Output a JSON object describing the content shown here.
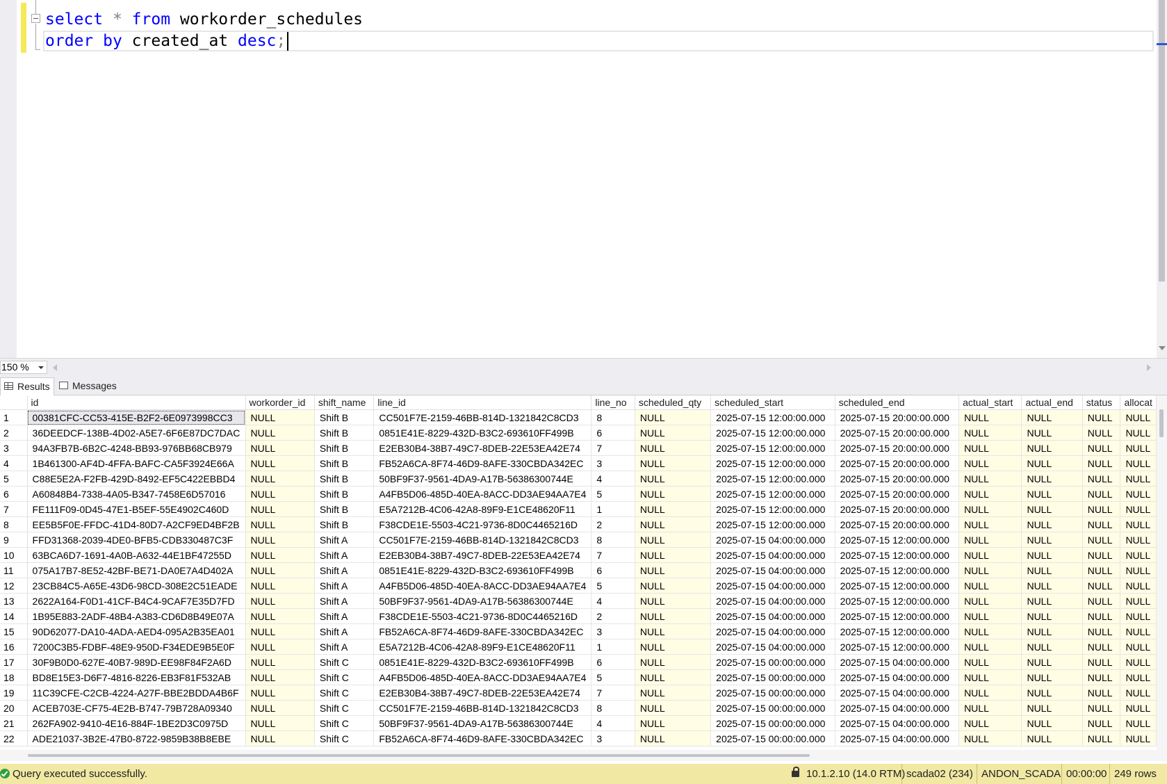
{
  "editor": {
    "line1": {
      "kw1": "select",
      "op": "*",
      "kw2": "from",
      "ident": "workorder_schedules"
    },
    "line2": {
      "kw1": "order",
      "kw2": "by",
      "ident": "created_at",
      "kw3": "desc",
      "punct": ";"
    }
  },
  "zoom": {
    "value": "150 %"
  },
  "tabs": {
    "results": "Results",
    "messages": "Messages"
  },
  "grid": {
    "columns": [
      "",
      "id",
      "workorder_id",
      "shift_name",
      "line_id",
      "line_no",
      "scheduled_qty",
      "scheduled_start",
      "scheduled_end",
      "actual_start",
      "actual_end",
      "status",
      "allocat"
    ],
    "rows": [
      [
        "1",
        "00381CFC-CC53-415E-B2F2-6E0973998CC3",
        "NULL",
        "Shift B",
        "CC501F7E-2159-46BB-814D-1321842C8CD3",
        "8",
        "NULL",
        "2025-07-15 12:00:00.000",
        "2025-07-15 20:00:00.000",
        "NULL",
        "NULL",
        "NULL",
        "NULL"
      ],
      [
        "2",
        "36DEEDCF-138B-4D02-A5E7-6F6E87DC7DAC",
        "NULL",
        "Shift B",
        "0851E41E-8229-432D-B3C2-693610FF499B",
        "6",
        "NULL",
        "2025-07-15 12:00:00.000",
        "2025-07-15 20:00:00.000",
        "NULL",
        "NULL",
        "NULL",
        "NULL"
      ],
      [
        "3",
        "94A3FB7B-6B2C-4248-BB93-976BB68CB979",
        "NULL",
        "Shift B",
        "E2EB30B4-38B7-49C7-8DEB-22E53EA42E74",
        "7",
        "NULL",
        "2025-07-15 12:00:00.000",
        "2025-07-15 20:00:00.000",
        "NULL",
        "NULL",
        "NULL",
        "NULL"
      ],
      [
        "4",
        "1B461300-AF4D-4FFA-BAFC-CA5F3924E66A",
        "NULL",
        "Shift B",
        "FB52A6CA-8F74-46D9-8AFE-330CBDA342EC",
        "3",
        "NULL",
        "2025-07-15 12:00:00.000",
        "2025-07-15 20:00:00.000",
        "NULL",
        "NULL",
        "NULL",
        "NULL"
      ],
      [
        "5",
        "C88E5E2A-F2FB-429D-8492-EF5C422EBBD4",
        "NULL",
        "Shift B",
        "50BF9F37-9561-4DA9-A17B-56386300744E",
        "4",
        "NULL",
        "2025-07-15 12:00:00.000",
        "2025-07-15 20:00:00.000",
        "NULL",
        "NULL",
        "NULL",
        "NULL"
      ],
      [
        "6",
        "A60848B4-7338-4A05-B347-7458E6D57016",
        "NULL",
        "Shift B",
        "A4FB5D06-485D-40EA-8ACC-DD3AE94AA7E4",
        "5",
        "NULL",
        "2025-07-15 12:00:00.000",
        "2025-07-15 20:00:00.000",
        "NULL",
        "NULL",
        "NULL",
        "NULL"
      ],
      [
        "7",
        "FE111F09-0D45-47E1-B5EF-55E4902C460D",
        "NULL",
        "Shift B",
        "E5A7212B-4C06-42A8-89F9-E1CE48620F11",
        "1",
        "NULL",
        "2025-07-15 12:00:00.000",
        "2025-07-15 20:00:00.000",
        "NULL",
        "NULL",
        "NULL",
        "NULL"
      ],
      [
        "8",
        "EE5B5F0E-FFDC-41D4-80D7-A2CF9ED4BF2B",
        "NULL",
        "Shift B",
        "F38CDE1E-5503-4C21-9736-8D0C4465216D",
        "2",
        "NULL",
        "2025-07-15 12:00:00.000",
        "2025-07-15 20:00:00.000",
        "NULL",
        "NULL",
        "NULL",
        "NULL"
      ],
      [
        "9",
        "FFD31368-2039-4DE0-BFB5-CDB330487C3F",
        "NULL",
        "Shift A",
        "CC501F7E-2159-46BB-814D-1321842C8CD3",
        "8",
        "NULL",
        "2025-07-15 04:00:00.000",
        "2025-07-15 12:00:00.000",
        "NULL",
        "NULL",
        "NULL",
        "NULL"
      ],
      [
        "10",
        "63BCA6D7-1691-4A0B-A632-44E1BF47255D",
        "NULL",
        "Shift A",
        "E2EB30B4-38B7-49C7-8DEB-22E53EA42E74",
        "7",
        "NULL",
        "2025-07-15 04:00:00.000",
        "2025-07-15 12:00:00.000",
        "NULL",
        "NULL",
        "NULL",
        "NULL"
      ],
      [
        "11",
        "075A17B7-8E52-42BF-BE71-DA0E7A4D402A",
        "NULL",
        "Shift A",
        "0851E41E-8229-432D-B3C2-693610FF499B",
        "6",
        "NULL",
        "2025-07-15 04:00:00.000",
        "2025-07-15 12:00:00.000",
        "NULL",
        "NULL",
        "NULL",
        "NULL"
      ],
      [
        "12",
        "23CB84C5-A65E-43D6-98CD-308E2C51EADE",
        "NULL",
        "Shift A",
        "A4FB5D06-485D-40EA-8ACC-DD3AE94AA7E4",
        "5",
        "NULL",
        "2025-07-15 04:00:00.000",
        "2025-07-15 12:00:00.000",
        "NULL",
        "NULL",
        "NULL",
        "NULL"
      ],
      [
        "13",
        "2622A164-F0D1-41CF-B4C4-9CAF7E35D7FD",
        "NULL",
        "Shift A",
        "50BF9F37-9561-4DA9-A17B-56386300744E",
        "4",
        "NULL",
        "2025-07-15 04:00:00.000",
        "2025-07-15 12:00:00.000",
        "NULL",
        "NULL",
        "NULL",
        "NULL"
      ],
      [
        "14",
        "1B95E883-2ADF-48B4-A383-CD6D8B49E07A",
        "NULL",
        "Shift A",
        "F38CDE1E-5503-4C21-9736-8D0C4465216D",
        "2",
        "NULL",
        "2025-07-15 04:00:00.000",
        "2025-07-15 12:00:00.000",
        "NULL",
        "NULL",
        "NULL",
        "NULL"
      ],
      [
        "15",
        "90D62077-DA10-4ADA-AED4-095A2B35EA01",
        "NULL",
        "Shift A",
        "FB52A6CA-8F74-46D9-8AFE-330CBDA342EC",
        "3",
        "NULL",
        "2025-07-15 04:00:00.000",
        "2025-07-15 12:00:00.000",
        "NULL",
        "NULL",
        "NULL",
        "NULL"
      ],
      [
        "16",
        "7200C3B5-FDBF-48E9-950D-F34EDE9B5E0F",
        "NULL",
        "Shift A",
        "E5A7212B-4C06-42A8-89F9-E1CE48620F11",
        "1",
        "NULL",
        "2025-07-15 04:00:00.000",
        "2025-07-15 12:00:00.000",
        "NULL",
        "NULL",
        "NULL",
        "NULL"
      ],
      [
        "17",
        "30F9B0D0-627E-40B7-989D-EE98F84F2A6D",
        "NULL",
        "Shift C",
        "0851E41E-8229-432D-B3C2-693610FF499B",
        "6",
        "NULL",
        "2025-07-15 00:00:00.000",
        "2025-07-15 04:00:00.000",
        "NULL",
        "NULL",
        "NULL",
        "NULL"
      ],
      [
        "18",
        "BD8E15E3-D6F7-4816-8226-EB3F81F532AB",
        "NULL",
        "Shift C",
        "A4FB5D06-485D-40EA-8ACC-DD3AE94AA7E4",
        "5",
        "NULL",
        "2025-07-15 00:00:00.000",
        "2025-07-15 04:00:00.000",
        "NULL",
        "NULL",
        "NULL",
        "NULL"
      ],
      [
        "19",
        "11C39CFE-C2CB-4224-A27F-BBE2BDDA4B6F",
        "NULL",
        "Shift C",
        "E2EB30B4-38B7-49C7-8DEB-22E53EA42E74",
        "7",
        "NULL",
        "2025-07-15 00:00:00.000",
        "2025-07-15 04:00:00.000",
        "NULL",
        "NULL",
        "NULL",
        "NULL"
      ],
      [
        "20",
        "ACEB703E-CF75-4E2B-B747-79B728A09340",
        "NULL",
        "Shift C",
        "CC501F7E-2159-46BB-814D-1321842C8CD3",
        "8",
        "NULL",
        "2025-07-15 00:00:00.000",
        "2025-07-15 04:00:00.000",
        "NULL",
        "NULL",
        "NULL",
        "NULL"
      ],
      [
        "21",
        "262FA902-9410-4E16-884F-1BE2D3C0975D",
        "NULL",
        "Shift C",
        "50BF9F37-9561-4DA9-A17B-56386300744E",
        "4",
        "NULL",
        "2025-07-15 00:00:00.000",
        "2025-07-15 04:00:00.000",
        "NULL",
        "NULL",
        "NULL",
        "NULL"
      ],
      [
        "22",
        "ADE21037-3B2E-47B0-8722-9859B38B8EBE",
        "NULL",
        "Shift C",
        "FB52A6CA-8F74-46D9-8AFE-330CBDA342EC",
        "3",
        "NULL",
        "2025-07-15 00:00:00.000",
        "2025-07-15 04:00:00.000",
        "NULL",
        "NULL",
        "NULL",
        "NULL"
      ]
    ]
  },
  "status": {
    "message": "Query executed successfully.",
    "server": "10.1.2.10 (14.0 RTM)",
    "login": "scada02 (234)",
    "database": "ANDON_SCADA",
    "elapsed": "00:00:00",
    "rows": "249 rows"
  },
  "icons": {
    "status": "success-check-icon",
    "lock": "lock-icon",
    "results": "grid-icon",
    "messages": "messages-icon"
  },
  "colors": {
    "keyword": "#0000ff",
    "null_cell": "#fffde4",
    "status_bar": "#f1e8a4",
    "change_marker": "#f5e95a"
  }
}
